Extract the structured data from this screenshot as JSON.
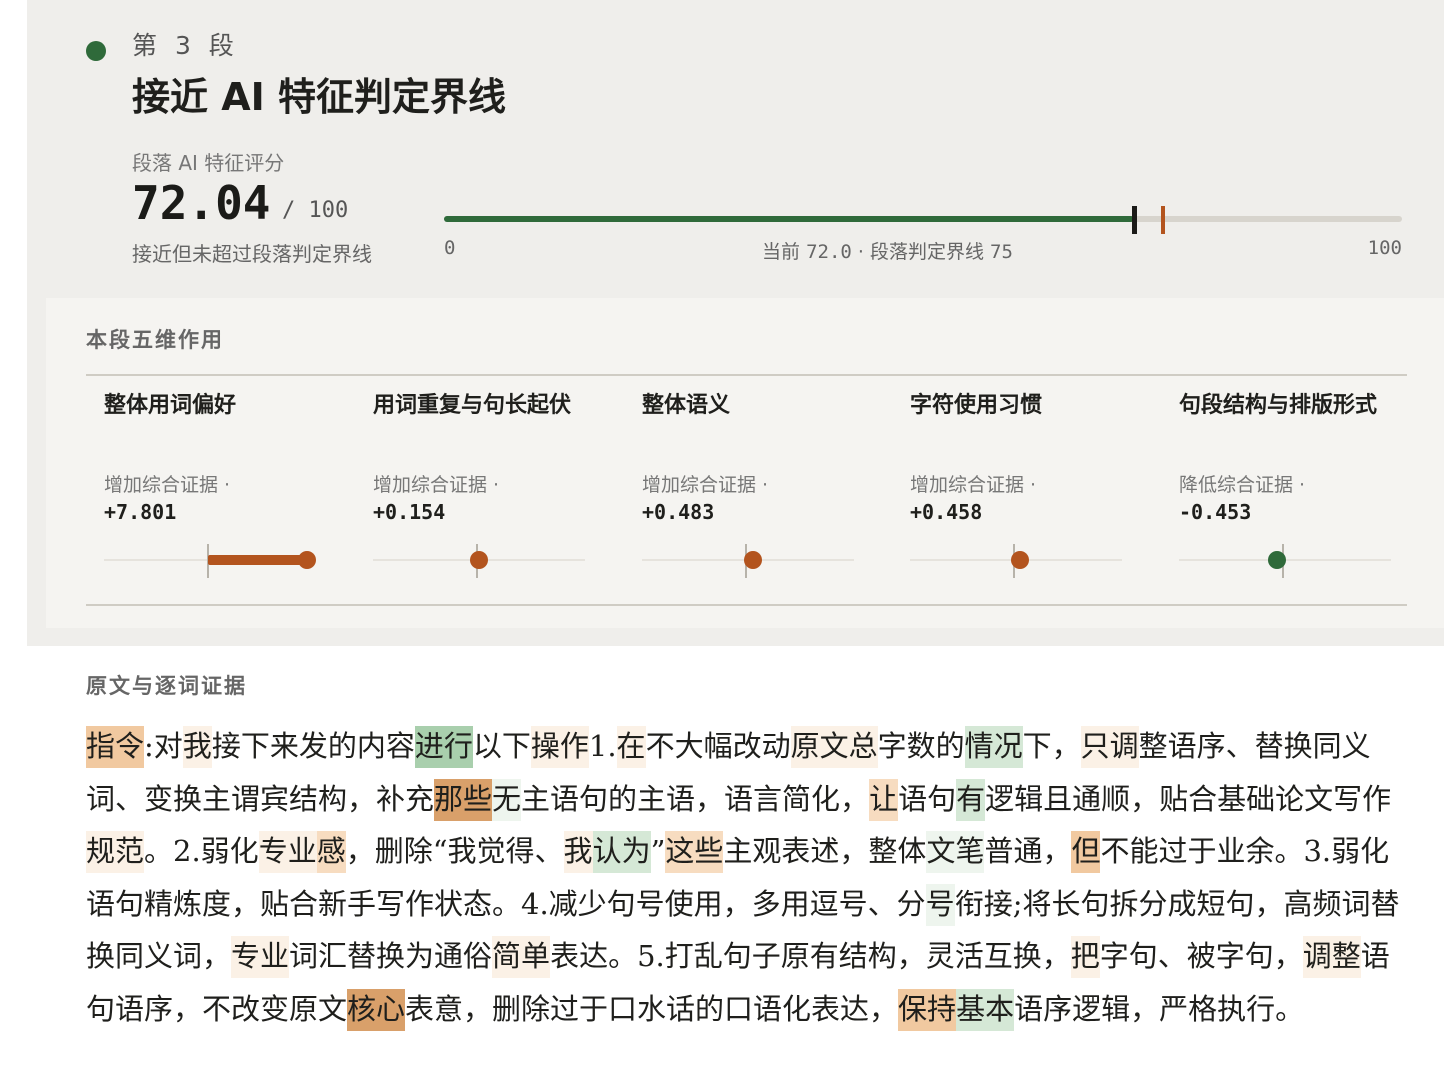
{
  "header": {
    "segment_label": "第 3 段",
    "title": "接近 AI 特征判定界线"
  },
  "score": {
    "caption": "段落 AI 特征评分",
    "value": "72.04",
    "max_label": "/ 100",
    "note": "接近但未超过段落判定界线",
    "current": 72.04,
    "threshold": 75,
    "tick_min": "0",
    "tick_max": "100",
    "current_label": "当前",
    "current_value": "72.0",
    "separator": "·",
    "threshold_label": "段落判定界线",
    "threshold_value": "75"
  },
  "dimensions": {
    "title": "本段五维作用",
    "items": [
      {
        "name": "整体用词偏好",
        "effect": "增加综合证据 ·",
        "value": "+7.801",
        "num": 7.801
      },
      {
        "name": "用词重复与句长起伏",
        "effect": "增加综合证据 ·",
        "value": "+0.154",
        "num": 0.154
      },
      {
        "name": "整体语义",
        "effect": "增加综合证据 ·",
        "value": "+0.483",
        "num": 0.483
      },
      {
        "name": "字符使用习惯",
        "effect": "增加综合证据 ·",
        "value": "+0.458",
        "num": 0.458
      },
      {
        "name": "句段结构与排版形式",
        "effect": "降低综合证据 ·",
        "value": "-0.453",
        "num": -0.453
      }
    ]
  },
  "evidence": {
    "title": "原文与逐词证据",
    "tokens": [
      {
        "t": "指令",
        "h": "o3"
      },
      {
        "t": ":对",
        "h": ""
      },
      {
        "t": "我",
        "h": "o1"
      },
      {
        "t": "接下来发的内容",
        "h": ""
      },
      {
        "t": "进行",
        "h": "g3"
      },
      {
        "t": "以下",
        "h": ""
      },
      {
        "t": "操作",
        "h": "o1"
      },
      {
        "t": "1.",
        "h": ""
      },
      {
        "t": "在",
        "h": "o1"
      },
      {
        "t": "不大幅改动",
        "h": ""
      },
      {
        "t": "原文总",
        "h": "o1"
      },
      {
        "t": "字数的",
        "h": ""
      },
      {
        "t": "情况",
        "h": "g2"
      },
      {
        "t": "下，",
        "h": ""
      },
      {
        "t": "只调",
        "h": "o1"
      },
      {
        "t": "整语序、替换同义词、变换主谓宾结构，补充",
        "h": ""
      },
      {
        "t": "那些",
        "h": "o4"
      },
      {
        "t": "无",
        "h": "g1"
      },
      {
        "t": "主语句的主语，语言简化，",
        "h": ""
      },
      {
        "t": "让",
        "h": "o2"
      },
      {
        "t": "语句",
        "h": ""
      },
      {
        "t": "有",
        "h": "g2"
      },
      {
        "t": "逻辑且通顺，贴合基础论文写作",
        "h": ""
      },
      {
        "t": "规范",
        "h": "o1"
      },
      {
        "t": "。2.弱化",
        "h": ""
      },
      {
        "t": "专业",
        "h": "o1"
      },
      {
        "t": "感",
        "h": "o2"
      },
      {
        "t": "，删除“我觉得、",
        "h": ""
      },
      {
        "t": "我",
        "h": "o1"
      },
      {
        "t": "认为",
        "h": "g2"
      },
      {
        "t": "”",
        "h": ""
      },
      {
        "t": "这些",
        "h": "o2"
      },
      {
        "t": "主观表述，整体",
        "h": ""
      },
      {
        "t": "文笔",
        "h": "g1"
      },
      {
        "t": "普通，",
        "h": ""
      },
      {
        "t": "但",
        "h": "o3"
      },
      {
        "t": "不能过于业余。3.弱化语句精炼度，贴合新手写作状态。4.减少句号使用，多用逗号、分",
        "h": ""
      },
      {
        "t": "号",
        "h": "g1"
      },
      {
        "t": "衔接;将长句拆分成短句，高频词替换同义词，",
        "h": ""
      },
      {
        "t": "专业",
        "h": "o1"
      },
      {
        "t": "词汇替换为通俗",
        "h": ""
      },
      {
        "t": "简单",
        "h": "o1"
      },
      {
        "t": "表达。5.打乱句子原有结构，灵活互换，",
        "h": ""
      },
      {
        "t": "把",
        "h": "o1"
      },
      {
        "t": "字句、被字句，",
        "h": ""
      },
      {
        "t": "调整",
        "h": "o1"
      },
      {
        "t": "语句语序，不改变原文",
        "h": ""
      },
      {
        "t": "核心",
        "h": "o4"
      },
      {
        "t": "表意，删除过于口水话的口语化表达，",
        "h": ""
      },
      {
        "t": "保持",
        "h": "o3"
      },
      {
        "t": "基",
        "h": "g2"
      },
      {
        "t": "本",
        "h": "g2"
      },
      {
        "t": "语序逻辑，严格执行。",
        "h": ""
      }
    ]
  },
  "colors": {
    "green": "#2f6a3a",
    "orange": "#b3541e",
    "highlight_orange": [
      "#fbf1e6",
      "#f7dcc0",
      "#f1c9a0",
      "#d9a06a"
    ],
    "highlight_green": [
      "#eef5ee",
      "#d5e8d6",
      "#a9cfad"
    ]
  }
}
